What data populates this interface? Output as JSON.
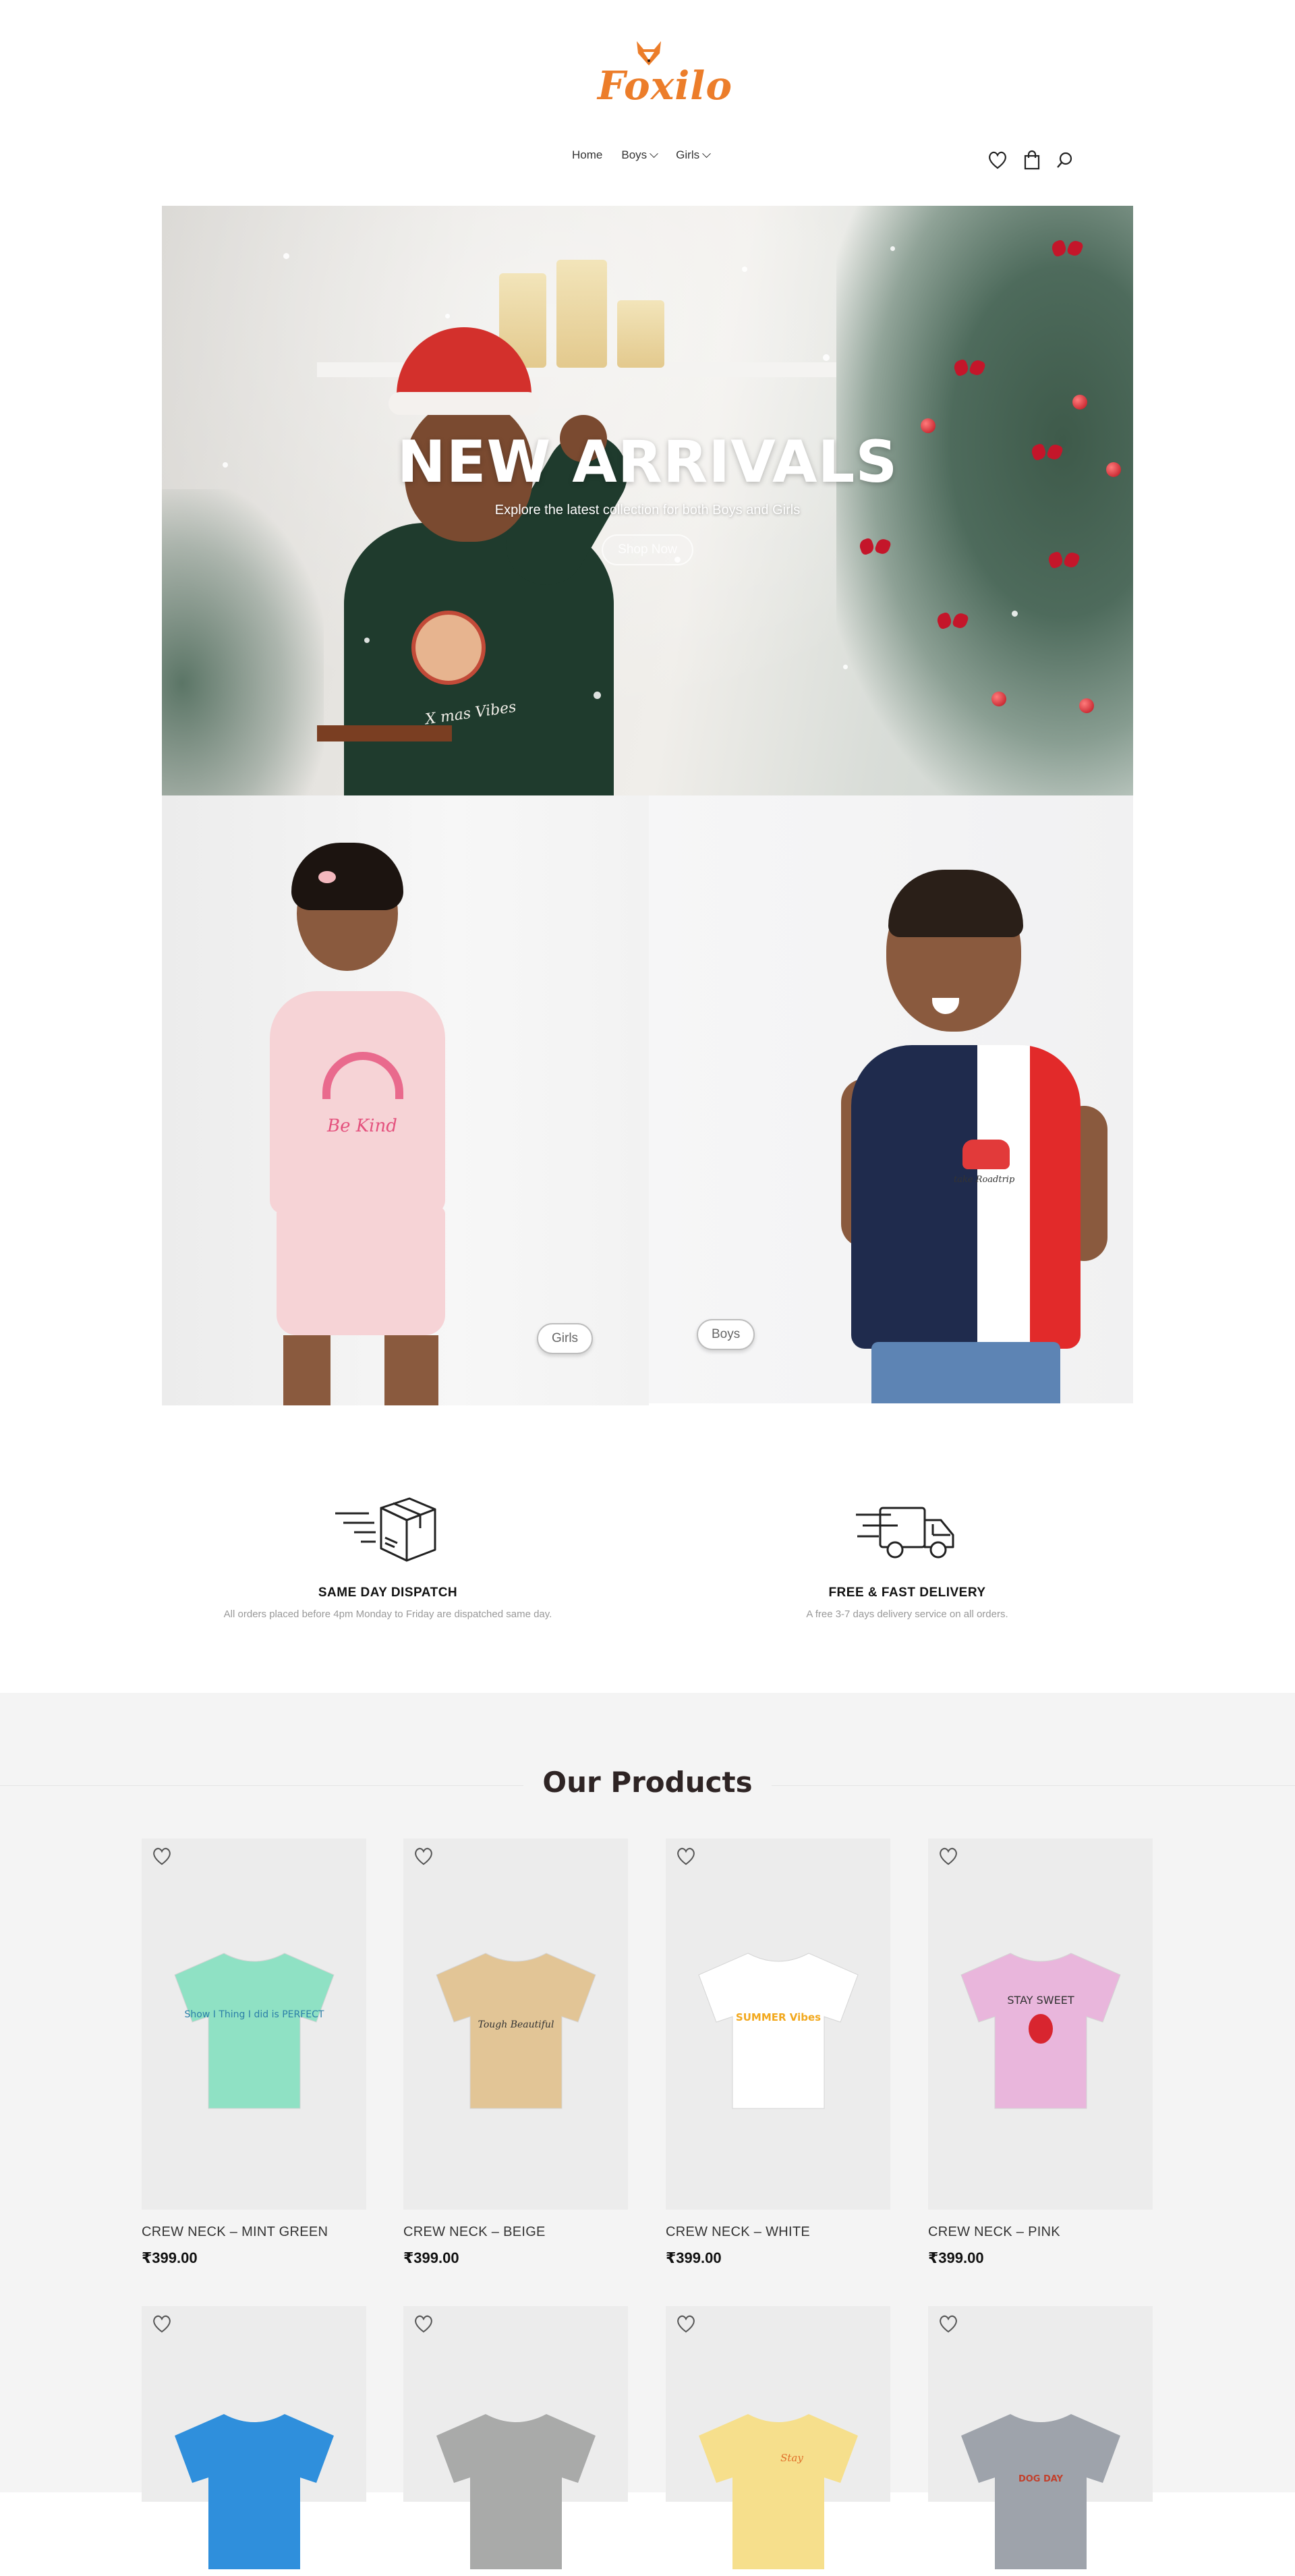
{
  "brand": {
    "name": "Foxilo",
    "logo_color": "#ec7d2a"
  },
  "nav": {
    "items": [
      {
        "label": "Home",
        "has_dropdown": false
      },
      {
        "label": "Boys",
        "has_dropdown": true
      },
      {
        "label": "Girls",
        "has_dropdown": true
      }
    ],
    "icons": [
      "heart-icon",
      "shopping-bag-icon",
      "search-icon"
    ]
  },
  "hero": {
    "title": "NEW ARRIVALS",
    "subtitle": "Explore the latest collection for both Boys and Girls",
    "button_label": "Shop Now",
    "sweater_caption": "X mas Vibes"
  },
  "categories": {
    "girls": {
      "button_label": "Girls",
      "shirt_text": "Be Kind"
    },
    "boys": {
      "button_label": "Boys",
      "shirt_text": "take Roadtrip"
    }
  },
  "features": [
    {
      "icon": "box-dispatch-icon",
      "title": "SAME DAY DISPATCH",
      "description": "All orders placed before 4pm Monday to Friday are dispatched same day."
    },
    {
      "icon": "delivery-truck-icon",
      "title": "FREE & FAST DELIVERY",
      "description": "A free 3-7 days delivery service on all orders."
    }
  ],
  "products": {
    "title": "Our Products",
    "items": [
      {
        "name": "CREW NECK – MINT GREEN",
        "price": "₹399.00",
        "color": "#8fe1c4",
        "print_text": "Show I Thing I did is PERFECT"
      },
      {
        "name": "CREW NECK – BEIGE",
        "price": "₹399.00",
        "color": "#e2c596",
        "print_text": "Tough Beautiful"
      },
      {
        "name": "CREW NECK – WHITE",
        "price": "₹399.00",
        "color": "#ffffff",
        "print_text": "SUMMER Vibes"
      },
      {
        "name": "CREW NECK – PINK",
        "price": "₹399.00",
        "color": "#e9b6dc",
        "print_text": "STAY SWEET"
      },
      {
        "color": "#2f8fdc"
      },
      {
        "color": "#a9aaa9"
      },
      {
        "color": "#f6df8c",
        "print_text": "Stay"
      },
      {
        "color": "#9ea3ab",
        "print_text": "DOG DAY"
      }
    ]
  }
}
